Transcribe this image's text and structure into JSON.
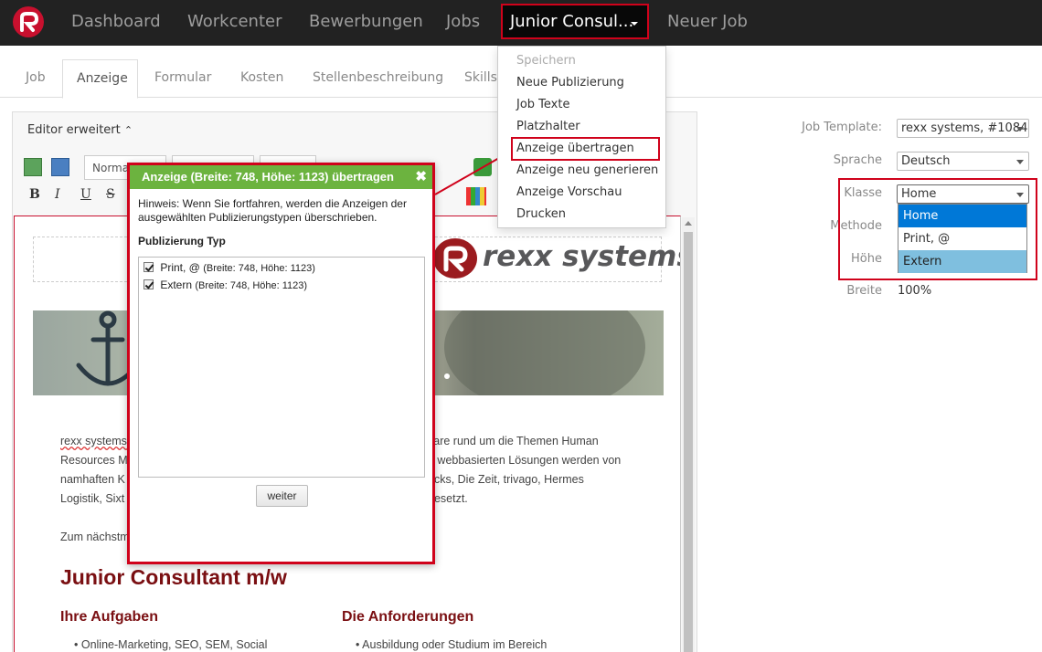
{
  "topnav": {
    "items": [
      "Dashboard",
      "Workcenter",
      "Bewerbungen",
      "Jobs"
    ],
    "active": "Junior Consul...",
    "new_job": "Neuer Job"
  },
  "tabs": {
    "items": [
      "Job",
      "Anzeige",
      "Formular",
      "Kosten",
      "Stellenbeschreibung",
      "Skills,"
    ],
    "active_index": 1
  },
  "editor": {
    "header": "Editor erweitert",
    "format_select": "Normal",
    "content": {
      "logo_text": "rexx systems",
      "para1_left": [
        "rexx systems",
        "Resources M",
        "namhaften K",
        "Logistik, Sixt"
      ],
      "para1_right": [
        "vare rund um die Themen Human",
        "e webbasierten Lösungen werden von",
        "ucks, Die Zeit, trivago, Hermes",
        "gesetzt."
      ],
      "para2": "Zum nächstm",
      "job_title": "Junior Consultant m/w",
      "col1_heading": "Ihre Aufgaben",
      "col2_heading": "Die Anforderungen",
      "col1_bullet": "Online-Marketing, SEO, SEM, Social",
      "col2_bullet": "Ausbildung oder Studium im Bereich"
    }
  },
  "modal": {
    "title": "Anzeige (Breite: 748, Höhe: 1123) übertragen",
    "hint": "Hinweis: Wenn Sie fortfahren, werden die Anzeigen der ausgewählten Publizierungstypen überschrieben.",
    "pub_title": "Publizierung Typ",
    "items": [
      {
        "label": "Print, @",
        "detail": "(Breite: 748, Höhe: 1123)",
        "checked": true
      },
      {
        "label": "Extern",
        "detail": "(Breite: 748, Höhe: 1123)",
        "checked": true
      }
    ],
    "button": "weiter"
  },
  "dropdown": {
    "items": [
      "Speichern",
      "Neue Publizierung",
      "Job Texte",
      "Platzhalter",
      "Anzeige übertragen",
      "Anzeige neu generieren",
      "Anzeige Vorschau",
      "Drucken"
    ],
    "disabled_index": 0,
    "highlighted_index": 4
  },
  "right_panel": {
    "job_template_label": "Job Template:",
    "job_template_value": "rexx systems, #1084",
    "sprache_label": "Sprache",
    "sprache_value": "Deutsch",
    "klasse_label": "Klasse",
    "klasse_value": "Home",
    "klasse_options": [
      "Home",
      "Print, @",
      "Extern"
    ],
    "methode_label": "Methode",
    "hoehe_label": "Höhe",
    "breite_label": "Breite",
    "breite_value": "100%"
  },
  "colors": {
    "nav_bg": "#222222",
    "highlight_red": "#d0021b",
    "modal_header_green": "#6cb33f",
    "title_dark_red": "#7a0f12",
    "option_selected": "#0078d7",
    "option_hover": "#7fbfdf"
  }
}
